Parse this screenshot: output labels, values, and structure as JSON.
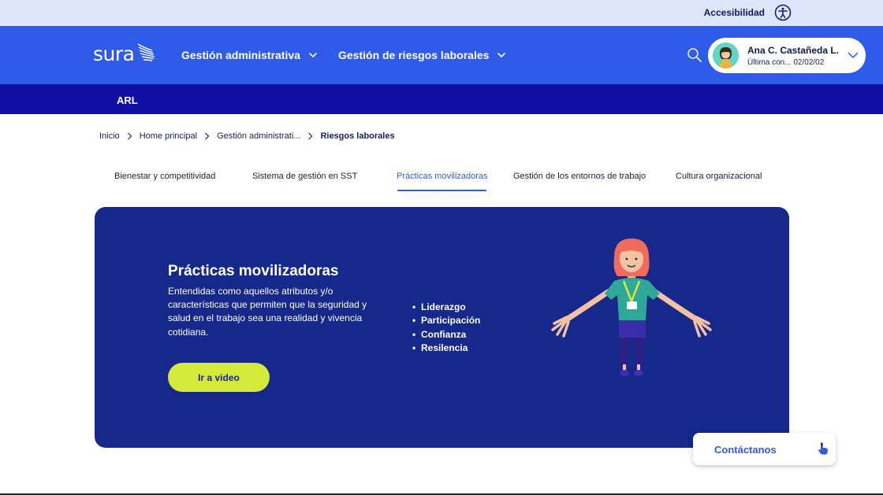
{
  "topbar": {
    "accessibility_label": "Accesibilidad"
  },
  "header": {
    "logo_text": "sura",
    "nav": [
      {
        "label": "Gestión administrativa"
      },
      {
        "label": "Gestión de riesgos laborales"
      }
    ],
    "user": {
      "name": "Ana C. Castañeda L.",
      "last_login": "Última con... 02/02/02"
    }
  },
  "subbar": {
    "label": "ARL"
  },
  "breadcrumb": [
    "Inicio",
    "Home principal",
    "Gestión administrati...",
    "Riesgos laborales"
  ],
  "tabs": [
    {
      "label": "Bienestar y competitividad"
    },
    {
      "label": "Sistema de gestión en SST"
    },
    {
      "label": "Prácticas movilizadoras",
      "active": true
    },
    {
      "label": "Gestión de los entornos de trabajo"
    },
    {
      "label": "Cultura organizacional"
    }
  ],
  "hero": {
    "title": "Prácticas movilizadoras",
    "description": "Entendidas como aquellos atributos y/o características que permiten que la seguridad y salud en el trabajo sea una realidad y vivencia cotidiana.",
    "list": [
      "Liderazgo",
      "Participación",
      "Confianza",
      "Resilencia"
    ],
    "cta_label": "Ir a video"
  },
  "contact": {
    "label": "Contáctanos"
  },
  "colors": {
    "topbar_bg": "#dde6fb",
    "header_bg": "#2e5bea",
    "subbar_bg": "#0f0fa3",
    "hero_bg": "#16288a",
    "cta_bg": "#d4e93a",
    "accent": "#2e5bea"
  },
  "icons": {
    "accessibility": "accessibility-icon",
    "search": "search-icon",
    "chevron": "chevron-down-icon",
    "breadcrumb_sep": "chevron-right-icon",
    "contact": "hand-pointer-icon"
  }
}
